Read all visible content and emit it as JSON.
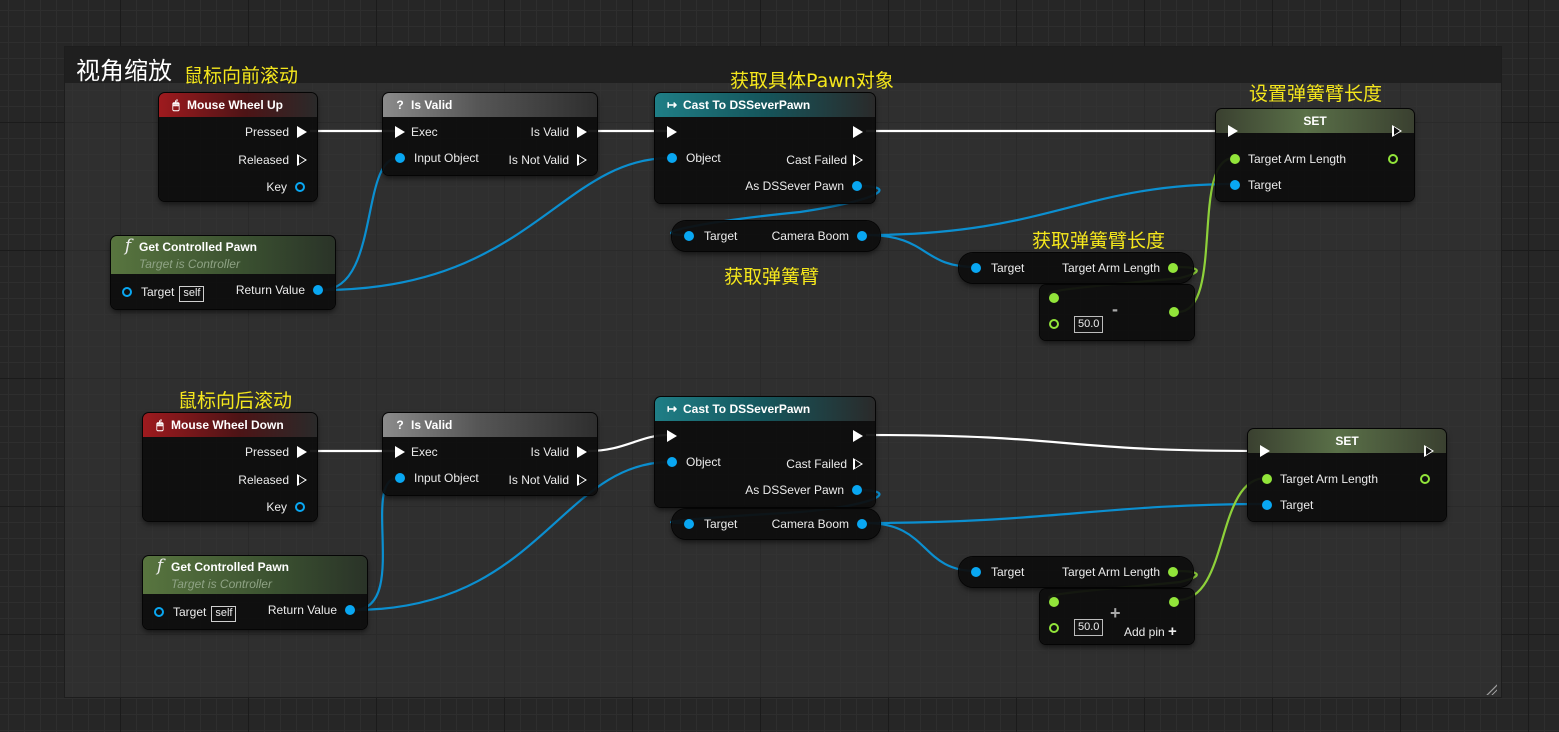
{
  "comment": {
    "title": "视角缩放"
  },
  "labels": {
    "wheel_up": "鼠标向前滚动",
    "wheel_down": "鼠标向后滚动",
    "cast_label": "获取具体Pawn对象",
    "set_label": "设置弹簧臂长度",
    "get_arm_label": "获取弹簧臂长度",
    "get_boom_label": "获取弹簧臂"
  },
  "nodes": {
    "wheel_up": {
      "title": "Mouse Wheel Up",
      "pressed": "Pressed",
      "released": "Released",
      "key": "Key"
    },
    "wheel_down": {
      "title": "Mouse Wheel Down",
      "pressed": "Pressed",
      "released": "Released",
      "key": "Key"
    },
    "is_valid": {
      "title": "Is Valid",
      "exec": "Exec",
      "input": "Input Object",
      "valid": "Is Valid",
      "not_valid": "Is Not Valid"
    },
    "get_pawn": {
      "title": "Get Controlled Pawn",
      "subtitle": "Target is Controller",
      "target": "Target",
      "self": "self",
      "ret": "Return Value"
    },
    "cast_up": {
      "title": "Cast To DSSeverPawn",
      "object": "Object",
      "failed": "Cast Failed",
      "as": "As DSSever Pawn"
    },
    "cast_down": {
      "title": "Cast To DSSeverPawn",
      "object": "Object",
      "failed": "Cast Failed",
      "as": "As DSSever Pawn"
    },
    "boom": {
      "target": "Target",
      "camera": "Camera Boom"
    },
    "arm_get": {
      "target": "Target",
      "arm": "Target Arm Length"
    },
    "sub": {
      "value": "50.0",
      "op": "-"
    },
    "add": {
      "value": "50.0",
      "op": "+",
      "add_pin": "Add pin"
    },
    "set": {
      "title": "SET",
      "arm": "Target Arm Length",
      "target": "Target"
    }
  },
  "colors": {
    "exec": "#ffffff",
    "object": "#09a7f2",
    "float": "#92e53a",
    "label": "#f5e71c"
  },
  "icons": {
    "event": "mouse-icon",
    "is_valid": "question-icon",
    "cast": "cast-arrow-icon",
    "function": "function-icon"
  }
}
